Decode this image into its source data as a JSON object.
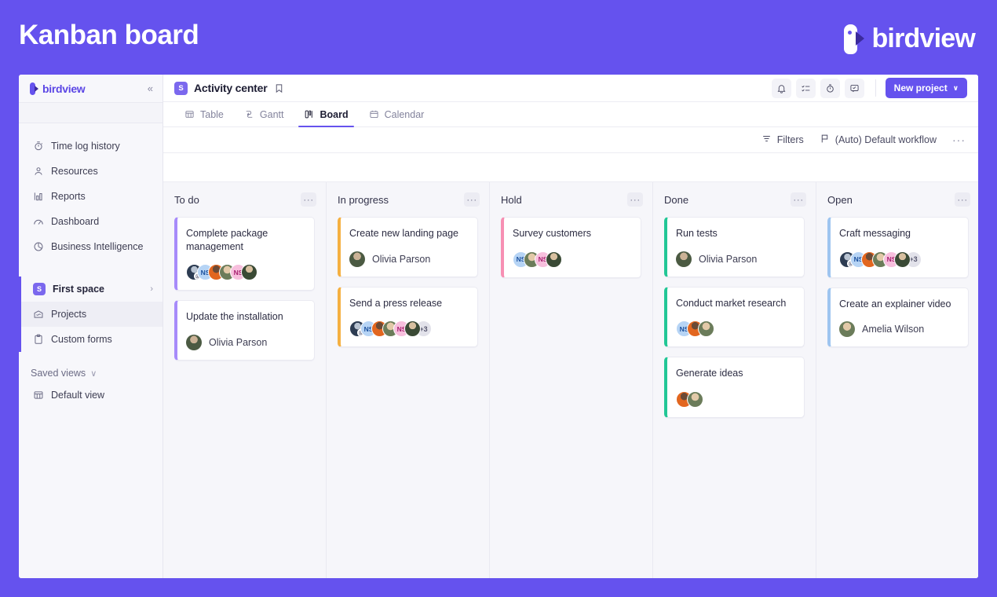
{
  "banner": {
    "title": "Kanban board",
    "brand": "birdview",
    "brand_color": "#6552ee"
  },
  "sidebar": {
    "logo_text": "birdview",
    "collapse_label": "«",
    "nav": [
      {
        "label": "Time log history",
        "icon": "stopwatch-icon"
      },
      {
        "label": "Resources",
        "icon": "person-icon"
      },
      {
        "label": "Reports",
        "icon": "bar-chart-icon"
      },
      {
        "label": "Dashboard",
        "icon": "gauge-icon"
      },
      {
        "label": "Business Intelligence",
        "icon": "pie-chart-icon"
      }
    ],
    "space": {
      "badge": "S",
      "name": "First space",
      "chevron": "›",
      "children": [
        {
          "label": "Projects",
          "icon": "folder-icon",
          "active": true
        },
        {
          "label": "Custom forms",
          "icon": "clipboard-icon",
          "active": false
        }
      ]
    },
    "saved_views": {
      "label": "Saved views",
      "chevron": "∨",
      "items": [
        {
          "label": "Default view",
          "icon": "table-icon"
        }
      ]
    }
  },
  "topbar": {
    "project_badge": "S",
    "project_title": "Activity center",
    "bookmark_icon": "bookmark-icon",
    "icons": [
      {
        "name": "bell-icon"
      },
      {
        "name": "checklist-icon"
      },
      {
        "name": "timer-icon"
      },
      {
        "name": "comment-icon"
      }
    ],
    "new_project_label": "New project",
    "new_project_chevron": "∨"
  },
  "tabs": [
    {
      "label": "Table",
      "icon": "table-icon",
      "active": false
    },
    {
      "label": "Gantt",
      "icon": "gantt-icon",
      "active": false
    },
    {
      "label": "Board",
      "icon": "board-icon",
      "active": true
    },
    {
      "label": "Calendar",
      "icon": "calendar-icon",
      "active": false
    }
  ],
  "filterbar": {
    "filters_label": "Filters",
    "workflow_label": "(Auto) Default workflow",
    "more_label": "···"
  },
  "board": {
    "column_menu_label": "···",
    "columns": [
      {
        "title": "To do",
        "accent": "#a78bfa",
        "cards": [
          {
            "title": "Complete package management",
            "mode": "stack",
            "avatars": [
              {
                "type": "photo",
                "style": "ph1",
                "badge": "image-icon"
              },
              {
                "type": "initials",
                "text": "NS",
                "style": "ns-blue"
              },
              {
                "type": "photo",
                "style": "ph2"
              },
              {
                "type": "photo",
                "style": "ph3"
              },
              {
                "type": "initials",
                "text": "NS",
                "style": "ns-pink"
              },
              {
                "type": "photo",
                "style": "ph4"
              }
            ],
            "more": null
          },
          {
            "title": "Update the installation",
            "mode": "single",
            "assignee": "Olivia Parson",
            "avatar": {
              "type": "photo",
              "style": "ph5"
            }
          }
        ]
      },
      {
        "title": "In progress",
        "accent": "#f5b041",
        "cards": [
          {
            "title": "Create new landing page",
            "mode": "single",
            "assignee": "Olivia Parson",
            "avatar": {
              "type": "photo",
              "style": "ph5"
            }
          },
          {
            "title": "Send a press release",
            "mode": "stack",
            "avatars": [
              {
                "type": "photo",
                "style": "ph1",
                "badge": "image-icon"
              },
              {
                "type": "initials",
                "text": "NS",
                "style": "ns-blue"
              },
              {
                "type": "photo",
                "style": "ph2"
              },
              {
                "type": "photo",
                "style": "ph3"
              },
              {
                "type": "initials",
                "text": "NS",
                "style": "ns-pink"
              },
              {
                "type": "photo",
                "style": "ph4"
              }
            ],
            "more": "+3"
          }
        ]
      },
      {
        "title": "Hold",
        "accent": "#f78fb3",
        "cards": [
          {
            "title": "Survey customers",
            "mode": "stack",
            "avatars": [
              {
                "type": "initials",
                "text": "NS",
                "style": "ns-blue"
              },
              {
                "type": "photo",
                "style": "ph3"
              },
              {
                "type": "initials",
                "text": "NS",
                "style": "ns-pink"
              },
              {
                "type": "photo",
                "style": "ph4"
              }
            ],
            "more": null
          }
        ]
      },
      {
        "title": "Done",
        "accent": "#22c796",
        "cards": [
          {
            "title": "Run tests",
            "mode": "single",
            "assignee": "Olivia Parson",
            "avatar": {
              "type": "photo",
              "style": "ph5"
            }
          },
          {
            "title": "Conduct market research",
            "mode": "stack",
            "avatars": [
              {
                "type": "initials",
                "text": "NS",
                "style": "ns-blue"
              },
              {
                "type": "photo",
                "style": "ph2"
              },
              {
                "type": "photo",
                "style": "ph3"
              }
            ],
            "more": null
          },
          {
            "title": "Generate ideas",
            "mode": "stack",
            "avatars": [
              {
                "type": "photo",
                "style": "ph2"
              },
              {
                "type": "photo",
                "style": "ph3"
              }
            ],
            "more": null
          }
        ]
      },
      {
        "title": "Open",
        "accent": "#9ec5f0",
        "cards": [
          {
            "title": "Craft messaging",
            "mode": "stack",
            "avatars": [
              {
                "type": "photo",
                "style": "ph1",
                "badge": "image-icon"
              },
              {
                "type": "initials",
                "text": "NS",
                "style": "ns-blue"
              },
              {
                "type": "photo",
                "style": "ph2"
              },
              {
                "type": "photo",
                "style": "ph3"
              },
              {
                "type": "initials",
                "text": "NS",
                "style": "ns-pink"
              },
              {
                "type": "photo",
                "style": "ph4"
              }
            ],
            "more": "+3"
          },
          {
            "title": "Create an explainer video",
            "mode": "single",
            "assignee": "Amelia Wilson",
            "avatar": {
              "type": "photo",
              "style": "ph3"
            }
          }
        ]
      }
    ]
  }
}
